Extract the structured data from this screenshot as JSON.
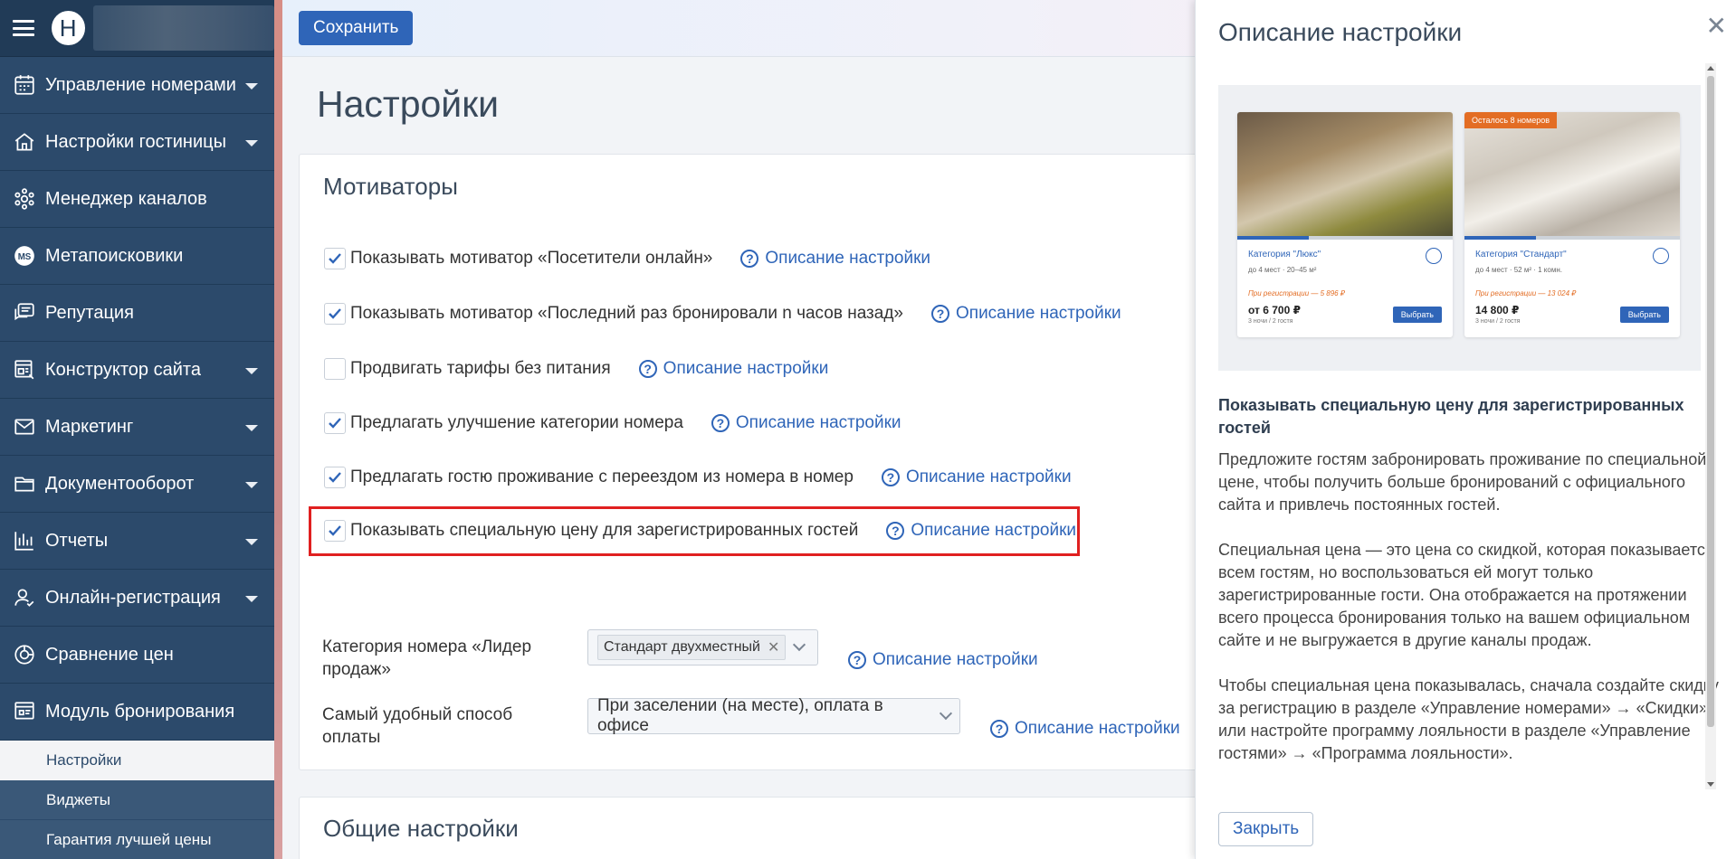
{
  "header": {
    "save_label": "Сохранить",
    "logo_letter": "Н"
  },
  "sidebar": {
    "items": [
      {
        "label": "Управление номерами",
        "icon": "calendar-icon",
        "caret": true
      },
      {
        "label": "Настройки гостиницы",
        "icon": "hotel-icon",
        "caret": true
      },
      {
        "label": "Менеджер каналов",
        "icon": "network-icon",
        "caret": false
      },
      {
        "label": "Метапоисковики",
        "icon": "ms-icon",
        "caret": false
      },
      {
        "label": "Репутация",
        "icon": "reviews-icon",
        "caret": false
      },
      {
        "label": "Конструктор сайта",
        "icon": "site-builder-icon",
        "caret": true
      },
      {
        "label": "Маркетинг",
        "icon": "mail-icon",
        "caret": true
      },
      {
        "label": "Документооборот",
        "icon": "folder-icon",
        "caret": true
      },
      {
        "label": "Отчеты",
        "icon": "bar-chart-icon",
        "caret": true
      },
      {
        "label": "Онлайн-регистрация",
        "icon": "user-check-icon",
        "caret": true
      },
      {
        "label": "Сравнение цен",
        "icon": "price-compare-icon",
        "caret": false
      },
      {
        "label": "Модуль бронирования",
        "icon": "booking-icon",
        "caret": false
      }
    ],
    "subitems": [
      "Настройки",
      "Виджеты",
      "Гарантия лучшей цены"
    ],
    "ms_badge": "MS"
  },
  "page": {
    "title": "Настройки"
  },
  "motivators": {
    "title": "Мотиваторы",
    "desc_label": "Описание настройки",
    "options": [
      {
        "label": "Показывать мотиватор «Посетители онлайн»",
        "checked": true
      },
      {
        "label": "Показывать мотиватор «Последний раз бронировали n часов назад»",
        "checked": true
      },
      {
        "label": "Продвигать тарифы без питания",
        "checked": false
      },
      {
        "label": "Предлагать улучшение категории номера",
        "checked": true
      },
      {
        "label": "Предлагать гостю проживание с переездом из номера в номер",
        "checked": true
      },
      {
        "label": "Показывать специальную цену для зарегистрированных гостей",
        "checked": true
      }
    ],
    "bestseller_label": "Категория номера «Лидер продаж»",
    "bestseller_value": "Стандарт двухместный",
    "payment_label": "Самый удобный способ оплаты",
    "payment_value": "При заселении (на месте), оплата в офисе"
  },
  "general": {
    "title": "Общие настройки"
  },
  "drawer": {
    "title": "Описание настройки",
    "heading": "Показывать специальную цену для зарегистрированных гостей",
    "p1": "Предложите гостям забронировать проживание по специальной цене, чтобы получить больше бронирований с официального сайта и привлечь постоянных гостей.",
    "p2": "Специальная цена — это цена со скидкой, которая показывается всем гостям, но воспользоваться ей могут только зарегистрированные гости. Она отображается на протяжении всего процесса бронирования только на вашем официальном сайте и не выгружается в другие каналы продаж.",
    "p3": "Чтобы специальная цена показывалась, сначала создайте скидку за регистрацию в разделе «Управление номерами» → «Скидки» или настройте программу лояльности в разделе «Управление гостями» → «Программа лояльности».",
    "close_label": "Закрыть",
    "preview": {
      "rooms": [
        {
          "name": "Категория \"Люкс\"",
          "meta": "до 4 мест · 20–45 м²",
          "promo": "При регистрации — 5 896 ₽",
          "price": "от 6 700 ₽",
          "sub": "3 ночи / 2 гостя",
          "btn": "Выбрать",
          "badge": ""
        },
        {
          "name": "Категория \"Стандарт\"",
          "meta": "до 4 мест · 52 м² · 1 комн.",
          "promo": "При регистрации — 13 024 ₽",
          "price": "14 800 ₽",
          "sub": "3 ночи / 2 гостя",
          "btn": "Выбрать",
          "badge": "Осталось 8 номеров"
        }
      ]
    }
  },
  "colors": {
    "sidebar": "#2c4a6b",
    "accent": "#2f65b8",
    "highlight": "#e02020"
  }
}
